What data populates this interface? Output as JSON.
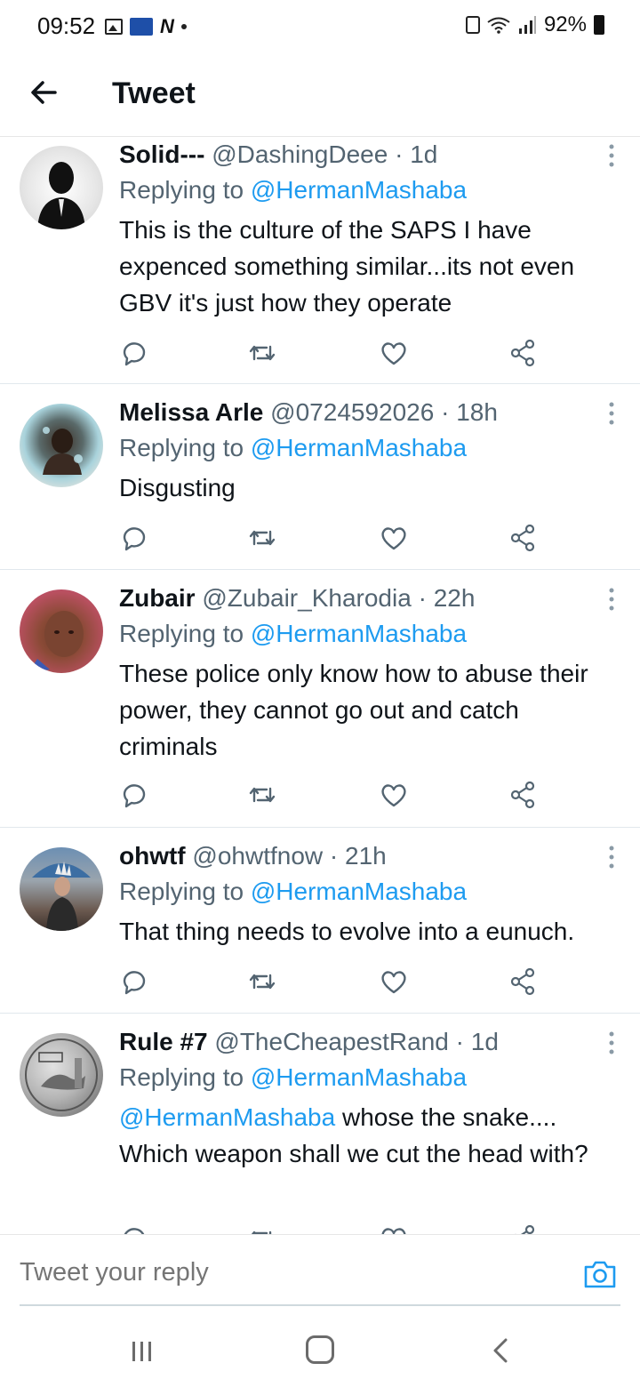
{
  "status_bar": {
    "time": "09:52",
    "battery": "92%",
    "news_badge": "N"
  },
  "header": {
    "title": "Tweet"
  },
  "tweets": [
    {
      "name": "Solid---",
      "handle": "@DashingDeee",
      "time": "1d",
      "replying_prefix": "Replying to",
      "replying_to": "@HermanMashaba",
      "text": "This is the culture of the SAPS I have expenced something similar...its not even GBV it's just how they operate"
    },
    {
      "name": "Melissa Arle",
      "handle": "@0724592026",
      "time": "18h",
      "replying_prefix": "Replying to",
      "replying_to": "@HermanMashaba",
      "text": "Disgusting"
    },
    {
      "name": "Zubair",
      "handle": "@Zubair_Kharodia",
      "time": "22h",
      "replying_prefix": "Replying to",
      "replying_to": "@HermanMashaba",
      "text": "These police only know how to abuse their power, they cannot go out and catch criminals"
    },
    {
      "name": "ohwtf",
      "handle": "@ohwtfnow",
      "time": "21h",
      "replying_prefix": "Replying to",
      "replying_to": "@HermanMashaba",
      "text": "That thing needs to evolve into a eunuch."
    },
    {
      "name": "Rule #7",
      "handle": "@TheCheapestRand",
      "time": "1d",
      "replying_prefix": "Replying to",
      "replying_to": "@HermanMashaba",
      "text_mention": "@HermanMashaba",
      "text": " whose the snake.... Which weapon shall we cut the head with?"
    }
  ],
  "reply_bar": {
    "placeholder": "Tweet your reply"
  },
  "icons": {
    "reply": "reply-icon",
    "retweet": "retweet-icon",
    "like": "like-icon",
    "share": "share-icon",
    "more": "more-vertical-icon",
    "camera": "camera-icon",
    "back": "back-arrow-icon"
  },
  "colors": {
    "link": "#1d9bf0",
    "secondary_text": "#536471",
    "icon": "#536471"
  }
}
